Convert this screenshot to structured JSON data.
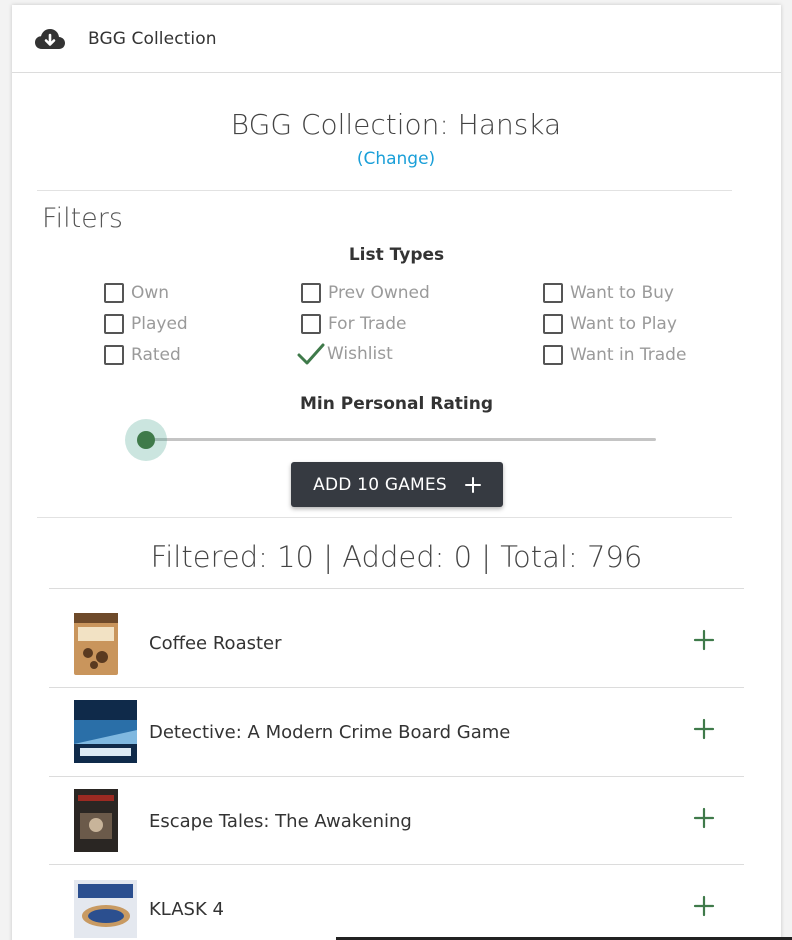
{
  "header": {
    "title": "BGG Collection",
    "icon": "cloud-download-icon"
  },
  "collection": {
    "title": "BGG Collection: Hanska",
    "change_label": "(Change)",
    "link_color": "#1a9fd8"
  },
  "filters": {
    "heading": "Filters",
    "list_types_label": "List Types",
    "options": [
      {
        "label": "Own",
        "checked": false
      },
      {
        "label": "Played",
        "checked": false
      },
      {
        "label": "Rated",
        "checked": false
      },
      {
        "label": "Prev Owned",
        "checked": false
      },
      {
        "label": "For Trade",
        "checked": false
      },
      {
        "label": "Wishlist",
        "checked": true
      },
      {
        "label": "Want to Buy",
        "checked": false
      },
      {
        "label": "Want to Play",
        "checked": false
      },
      {
        "label": "Want in Trade",
        "checked": false
      }
    ],
    "rating_label": "Min Personal Rating",
    "rating_value": 0
  },
  "add_button": {
    "label": "ADD 10 GAMES",
    "icon": "plus-icon"
  },
  "summary": "Filtered: 10 | Added: 0 | Total: 796",
  "games": [
    {
      "name": "Coffee Roaster"
    },
    {
      "name": "Detective: A Modern Crime Board Game"
    },
    {
      "name": "Escape Tales: The Awakening"
    },
    {
      "name": "KLASK 4"
    }
  ],
  "colors": {
    "accent_green": "#3f7a4a",
    "button_dark": "#363a41"
  }
}
